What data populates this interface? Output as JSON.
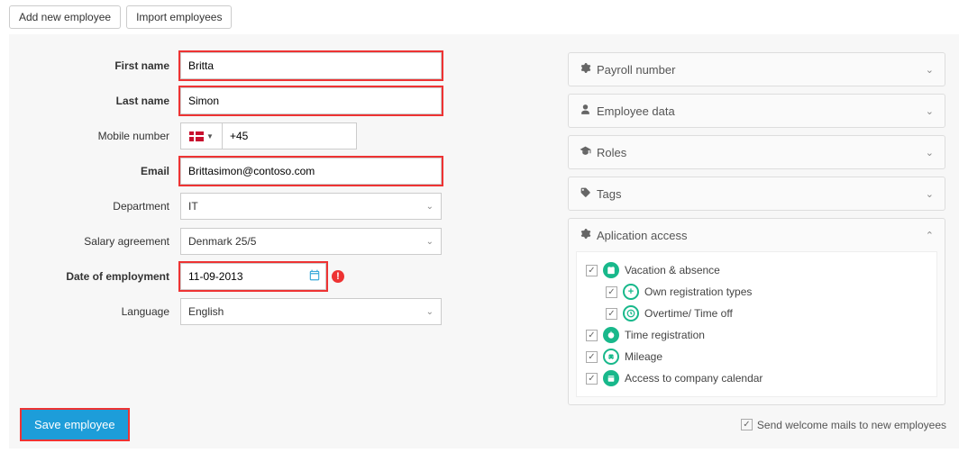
{
  "topbar": {
    "add_new": "Add new employee",
    "import": "Import employees"
  },
  "form": {
    "first_name": {
      "label": "First name",
      "value": "Britta"
    },
    "last_name": {
      "label": "Last name",
      "value": "Simon"
    },
    "mobile": {
      "label": "Mobile number",
      "prefix": "+45"
    },
    "email": {
      "label": "Email",
      "value": "Brittasimon@contoso.com"
    },
    "department": {
      "label": "Department",
      "value": "IT"
    },
    "salary": {
      "label": "Salary agreement",
      "value": "Denmark 25/5"
    },
    "doe": {
      "label": "Date of employment",
      "value": "11-09-2013"
    },
    "language": {
      "label": "Language",
      "value": "English"
    }
  },
  "panels": {
    "payroll": "Payroll number",
    "employee_data": "Employee data",
    "roles": "Roles",
    "tags": "Tags",
    "app_access": "Aplication access"
  },
  "access": {
    "vacation": "Vacation & absence",
    "own_reg": "Own registration types",
    "overtime": "Overtime/ Time off",
    "time_reg": "Time registration",
    "mileage": "Mileage",
    "calendar": "Access to company calendar"
  },
  "footer": {
    "save": "Save employee",
    "welcome": "Send welcome mails to new employees"
  }
}
